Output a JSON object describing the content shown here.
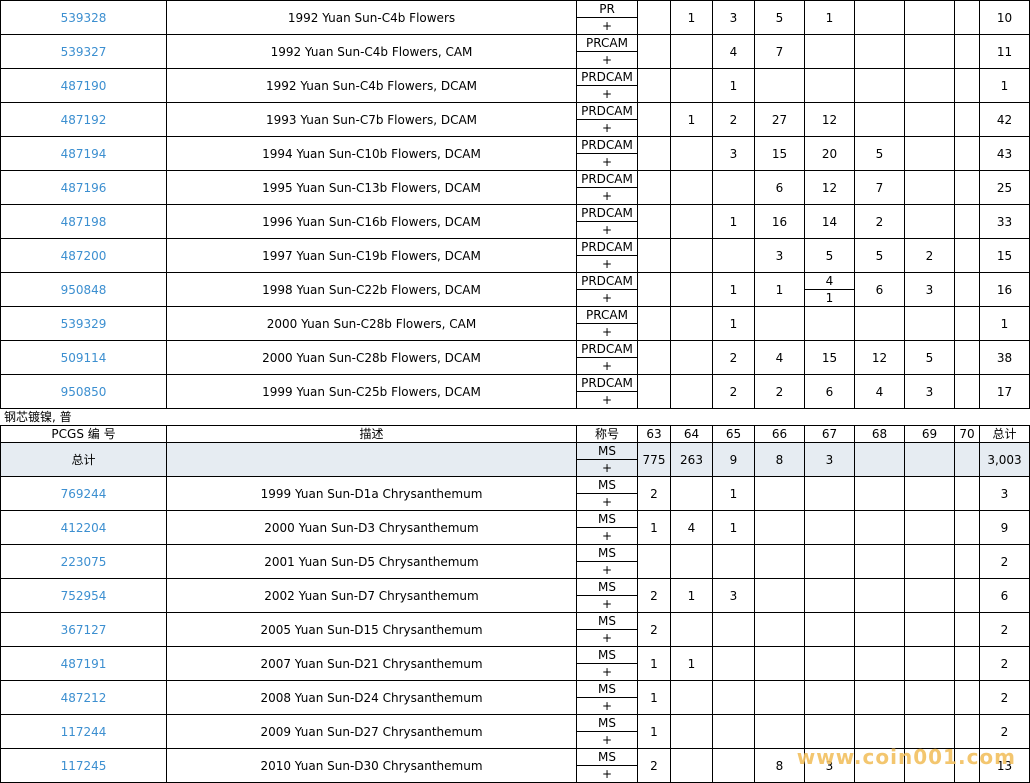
{
  "top_rows": [
    {
      "id": "539328",
      "desc": "1992 Yuan Sun-C4b Flowers",
      "grade_top": "PR",
      "grade_bot": "+",
      "c": [
        "",
        "1",
        "3",
        "5",
        "1",
        "",
        "",
        ""
      ],
      "total": "10"
    },
    {
      "id": "539327",
      "desc": "1992 Yuan Sun-C4b Flowers, CAM",
      "grade_top": "PRCAM",
      "grade_bot": "+",
      "c": [
        "",
        "",
        "4",
        "7",
        "",
        "",
        "",
        ""
      ],
      "total": "11"
    },
    {
      "id": "487190",
      "desc": "1992 Yuan Sun-C4b Flowers, DCAM",
      "grade_top": "PRDCAM",
      "grade_bot": "+",
      "c": [
        "",
        "",
        "1",
        "",
        "",
        "",
        "",
        ""
      ],
      "total": "1"
    },
    {
      "id": "487192",
      "desc": "1993 Yuan Sun-C7b Flowers, DCAM",
      "grade_top": "PRDCAM",
      "grade_bot": "+",
      "c": [
        "",
        "1",
        "2",
        "27",
        "12",
        "",
        "",
        ""
      ],
      "total": "42"
    },
    {
      "id": "487194",
      "desc": "1994 Yuan Sun-C10b Flowers, DCAM",
      "grade_top": "PRDCAM",
      "grade_bot": "+",
      "c": [
        "",
        "",
        "3",
        "15",
        "20",
        "5",
        "",
        ""
      ],
      "total": "43"
    },
    {
      "id": "487196",
      "desc": "1995 Yuan Sun-C13b Flowers, DCAM",
      "grade_top": "PRDCAM",
      "grade_bot": "+",
      "c": [
        "",
        "",
        "",
        "6",
        "12",
        "7",
        "",
        ""
      ],
      "total": "25"
    },
    {
      "id": "487198",
      "desc": "1996 Yuan Sun-C16b Flowers, DCAM",
      "grade_top": "PRDCAM",
      "grade_bot": "+",
      "c": [
        "",
        "",
        "1",
        "16",
        "14",
        "2",
        "",
        ""
      ],
      "total": "33"
    },
    {
      "id": "487200",
      "desc": "1997 Yuan Sun-C19b Flowers, DCAM",
      "grade_top": "PRDCAM",
      "grade_bot": "+",
      "c": [
        "",
        "",
        "",
        "3",
        "5",
        "5",
        "2",
        ""
      ],
      "total": "15"
    },
    {
      "id": "950848",
      "desc": "1998 Yuan Sun-C22b Flowers, DCAM",
      "grade_top": "PRDCAM",
      "grade_bot": "+",
      "c": [
        "",
        "",
        "1",
        "1",
        "SPLIT",
        "6",
        "3",
        ""
      ],
      "split_top": "4",
      "split_bot": "1",
      "total": "16"
    },
    {
      "id": "539329",
      "desc": "2000 Yuan Sun-C28b Flowers, CAM",
      "grade_top": "PRCAM",
      "grade_bot": "+",
      "c": [
        "",
        "",
        "1",
        "",
        "",
        "",
        "",
        ""
      ],
      "total": "1"
    },
    {
      "id": "509114",
      "desc": "2000 Yuan Sun-C28b Flowers, DCAM",
      "grade_top": "PRDCAM",
      "grade_bot": "+",
      "c": [
        "",
        "",
        "2",
        "4",
        "15",
        "12",
        "5",
        ""
      ],
      "total": "38"
    },
    {
      "id": "950850",
      "desc": "1999 Yuan Sun-C25b Flowers, DCAM",
      "grade_top": "PRDCAM",
      "grade_bot": "+",
      "c": [
        "",
        "",
        "2",
        "2",
        "6",
        "4",
        "3",
        ""
      ],
      "total": "17"
    }
  ],
  "section_title": "钢芯镀镍, 普",
  "header": {
    "pcgs": "PCGS 编 号",
    "desc": "描述",
    "grade": "称号",
    "cols": [
      "63",
      "64",
      "65",
      "66",
      "67",
      "68",
      "69",
      "70"
    ],
    "total": "总计"
  },
  "total_row": {
    "label": "总计",
    "desc": "",
    "grade_top": "MS",
    "grade_bot": "+",
    "c": [
      "775",
      "263",
      "9",
      "8",
      "3",
      "",
      "",
      ""
    ],
    "total": "3,003"
  },
  "bottom_rows": [
    {
      "id": "769244",
      "desc": "1999 Yuan Sun-D1a Chrysanthemum",
      "grade_top": "MS",
      "grade_bot": "+",
      "c": [
        "2",
        "",
        "1",
        "",
        "",
        "",
        "",
        ""
      ],
      "total": "3"
    },
    {
      "id": "412204",
      "desc": "2000 Yuan Sun-D3 Chrysanthemum",
      "grade_top": "MS",
      "grade_bot": "+",
      "c": [
        "1",
        "4",
        "1",
        "",
        "",
        "",
        "",
        ""
      ],
      "total": "9"
    },
    {
      "id": "223075",
      "desc": "2001 Yuan Sun-D5 Chrysanthemum",
      "grade_top": "MS",
      "grade_bot": "+",
      "c": [
        "",
        "",
        "",
        "",
        "",
        "",
        "",
        ""
      ],
      "total": "2"
    },
    {
      "id": "752954",
      "desc": "2002 Yuan Sun-D7 Chrysanthemum",
      "grade_top": "MS",
      "grade_bot": "+",
      "c": [
        "2",
        "1",
        "3",
        "",
        "",
        "",
        "",
        ""
      ],
      "total": "6"
    },
    {
      "id": "367127",
      "desc": "2005 Yuan Sun-D15 Chrysanthemum",
      "grade_top": "MS",
      "grade_bot": "+",
      "c": [
        "2",
        "",
        "",
        "",
        "",
        "",
        "",
        ""
      ],
      "total": "2"
    },
    {
      "id": "487191",
      "desc": "2007 Yuan Sun-D21 Chrysanthemum",
      "grade_top": "MS",
      "grade_bot": "+",
      "c": [
        "1",
        "1",
        "",
        "",
        "",
        "",
        "",
        ""
      ],
      "total": "2"
    },
    {
      "id": "487212",
      "desc": "2008 Yuan Sun-D24 Chrysanthemum",
      "grade_top": "MS",
      "grade_bot": "+",
      "c": [
        "1",
        "",
        "",
        "",
        "",
        "",
        "",
        ""
      ],
      "total": "2"
    },
    {
      "id": "117244",
      "desc": "2009 Yuan Sun-D27 Chrysanthemum",
      "grade_top": "MS",
      "grade_bot": "+",
      "c": [
        "1",
        "",
        "",
        "",
        "",
        "",
        "",
        ""
      ],
      "total": "2"
    },
    {
      "id": "117245",
      "desc": "2010 Yuan Sun-D30 Chrysanthemum",
      "grade_top": "MS",
      "grade_bot": "+",
      "c": [
        "2",
        "",
        "",
        "8",
        "3",
        "",
        "",
        ""
      ],
      "total": "13"
    }
  ],
  "watermark": "www.coin001.com"
}
